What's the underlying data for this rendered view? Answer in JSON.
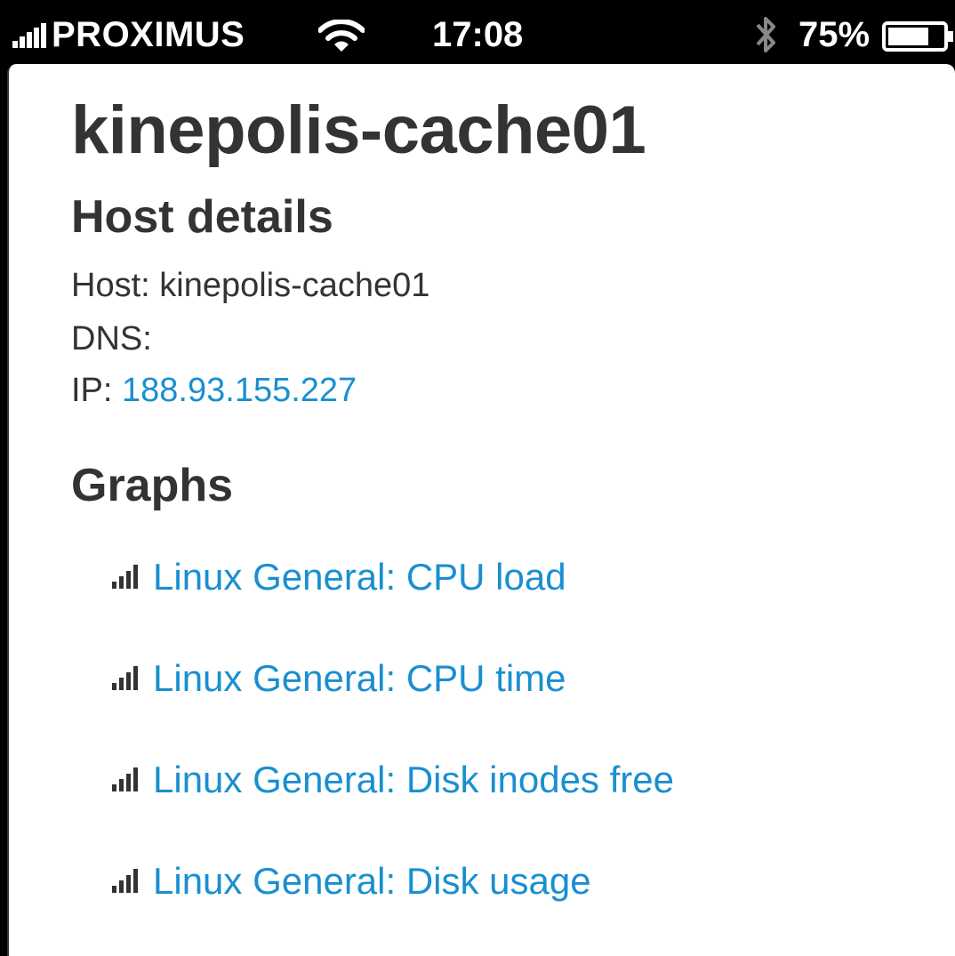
{
  "status_bar": {
    "carrier": "PROXIMUS",
    "time": "17:08",
    "battery_percent": "75%",
    "signal_icon": "signal-bars-icon",
    "wifi_icon": "wifi-icon",
    "bluetooth_icon": "bluetooth-icon",
    "battery_icon": "battery-icon",
    "battery_level": 0.75
  },
  "page": {
    "title": "kinepolis-cache01",
    "host_details": {
      "heading": "Host details",
      "host_label": "Host: ",
      "host_value": "kinepolis-cache01",
      "dns_label": "DNS:",
      "dns_value": "",
      "ip_label": "IP: ",
      "ip_value": "188.93.155.227"
    },
    "graphs": {
      "heading": "Graphs",
      "items": [
        {
          "label": "Linux General: CPU load",
          "icon": "bar-chart-icon"
        },
        {
          "label": "Linux General: CPU time",
          "icon": "bar-chart-icon"
        },
        {
          "label": "Linux General: Disk inodes free",
          "icon": "bar-chart-icon"
        },
        {
          "label": "Linux General: Disk usage",
          "icon": "bar-chart-icon"
        }
      ]
    }
  },
  "colors": {
    "link": "#1a8fd0",
    "text": "#333333",
    "status_bar_bg": "#000000"
  }
}
